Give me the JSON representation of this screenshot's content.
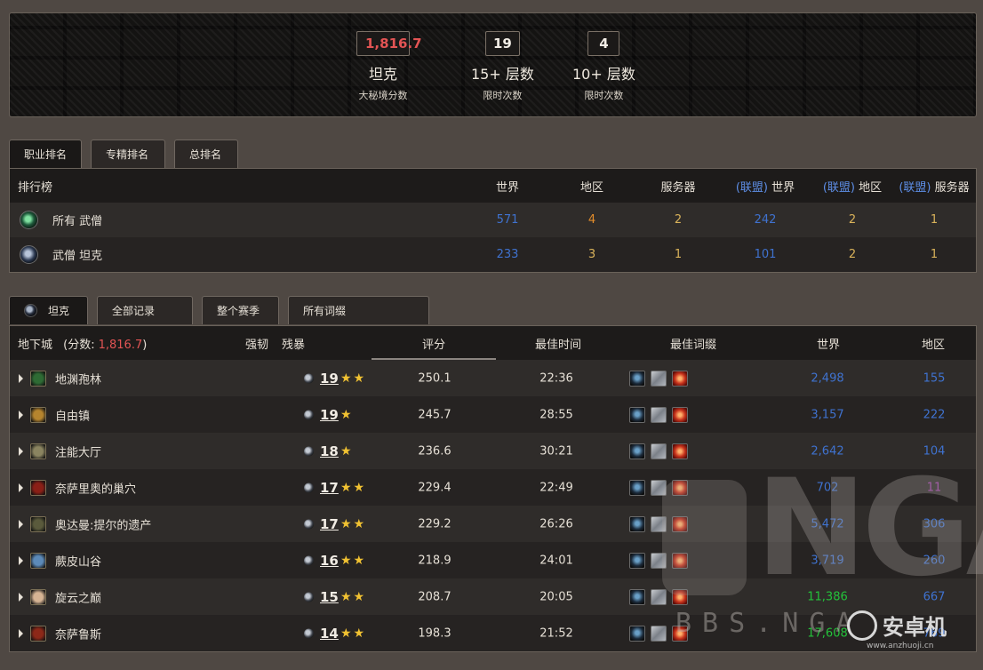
{
  "header": {
    "score": {
      "value": "1,816.7",
      "title": "坦克",
      "caption": "大秘境分数"
    },
    "runs15": {
      "value": "19",
      "title": "15+ 层数",
      "caption": "限时次数"
    },
    "runs10": {
      "value": "4",
      "title": "10+ 层数",
      "caption": "限时次数"
    }
  },
  "rank_tabs": [
    "职业排名",
    "专精排名",
    "总排名"
  ],
  "rank_table": {
    "label": "排行榜",
    "columns": {
      "world": "世界",
      "region": "地区",
      "server": "服务器",
      "alliance_tag": "(联盟)",
      "a_world": "世界",
      "a_region": "地区",
      "a_server": "服务器"
    },
    "rows": [
      {
        "name": "所有 武僧",
        "world": "571",
        "region": "4",
        "server": "2",
        "a_world": "242",
        "a_region": "2",
        "a_server": "1"
      },
      {
        "name": "武僧 坦克",
        "world": "233",
        "region": "3",
        "server": "1",
        "a_world": "101",
        "a_region": "2",
        "a_server": "1"
      }
    ]
  },
  "run_tabs": [
    "坦克",
    "全部记录",
    "整个赛季",
    "所有词缀"
  ],
  "dungeon_table": {
    "dungeon_label": "地下城",
    "score_prefix": "(分数:",
    "score_value": "1,816.7",
    "score_suffix": ")",
    "fortified": "强韧",
    "tyrannical": "残暴",
    "score": "评分",
    "best_time": "最佳时间",
    "best_affixes": "最佳词缀",
    "world": "世界",
    "region": "地区",
    "rows": [
      {
        "name": "地渊孢林",
        "level": "19",
        "stars": "★★",
        "score": "250.1",
        "time": "22:36",
        "world": "2,498",
        "region": "155",
        "icon_color": "#2e6b34"
      },
      {
        "name": "自由镇",
        "level": "19",
        "stars": "★",
        "score": "245.7",
        "time": "28:55",
        "world": "3,157",
        "region": "222",
        "icon_color": "#b5842e"
      },
      {
        "name": "注能大厅",
        "level": "18",
        "stars": "★",
        "score": "236.6",
        "time": "30:21",
        "world": "2,642",
        "region": "104",
        "icon_color": "#8a8460"
      },
      {
        "name": "奈萨里奥的巢穴",
        "level": "17",
        "stars": "★★",
        "score": "229.4",
        "time": "22:49",
        "world": "702",
        "region": "11",
        "icon_color": "#8a1f16"
      },
      {
        "name": "奥达曼:提尔的遗产",
        "level": "17",
        "stars": "★★",
        "score": "229.2",
        "time": "26:26",
        "world": "5,472",
        "region": "306",
        "icon_color": "#5a5a3c"
      },
      {
        "name": "蕨皮山谷",
        "level": "16",
        "stars": "★★",
        "score": "218.9",
        "time": "24:01",
        "world": "3,719",
        "region": "260",
        "icon_color": "#5c8ab8"
      },
      {
        "name": "旋云之巅",
        "level": "15",
        "stars": "★★",
        "score": "208.7",
        "time": "20:05",
        "world": "11,386",
        "region": "667",
        "icon_color": "#d6b494"
      },
      {
        "name": "奈萨鲁斯",
        "level": "14",
        "stars": "★★",
        "score": "198.3",
        "time": "21:52",
        "world": "17,608",
        "region": "769",
        "icon_color": "#8c2818"
      }
    ]
  },
  "watermark": {
    "brand": "NGA",
    "bbs": "BBS.NGA",
    "logo": "安卓机",
    "url": "www.anzhuoji.cn"
  },
  "colors": {
    "score_red": "#e35454",
    "rank_blue": "#3f72cf",
    "rank_orange": "#e28c2a",
    "rank_gold": "#d9b25a",
    "alliance_blue": "#5e8fe8",
    "green": "#23c23a",
    "purple": "#9d3ca8",
    "star": "#f1c232"
  }
}
